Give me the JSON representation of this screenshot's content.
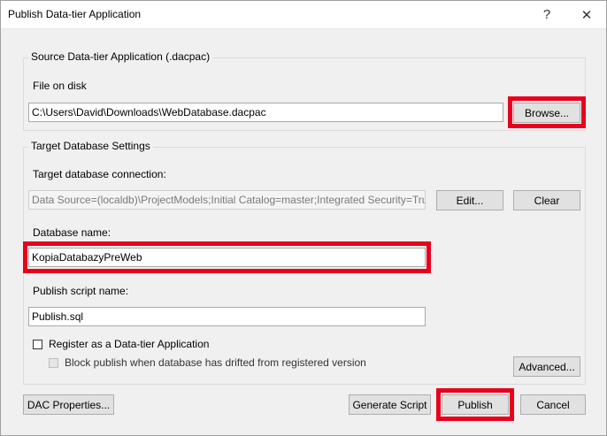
{
  "window": {
    "title": "Publish Data-tier Application",
    "help_glyph": "?",
    "close_glyph": "✕"
  },
  "source": {
    "group_title": "Source Data-tier Application (.dacpac)",
    "file_label": "File on disk",
    "file_value": "C:\\Users\\David\\Downloads\\WebDatabase.dacpac",
    "browse_label": "Browse..."
  },
  "target": {
    "group_title": "Target Database Settings",
    "connection_label": "Target database connection:",
    "connection_value": "Data Source=(localdb)\\ProjectModels;Initial Catalog=master;Integrated Security=Tru",
    "edit_label": "Edit...",
    "clear_label": "Clear",
    "dbname_label": "Database name:",
    "dbname_value": "KopiaDatabazyPreWeb",
    "script_label": "Publish script name:",
    "script_value": "Publish.sql",
    "register_label": "Register as a Data-tier Application",
    "register_checked": false,
    "block_label": "Block publish when database has drifted from registered version",
    "block_checked": false,
    "advanced_label": "Advanced..."
  },
  "footer": {
    "dac_properties_label": "DAC Properties...",
    "generate_script_label": "Generate Script",
    "publish_label": "Publish",
    "cancel_label": "Cancel"
  },
  "colors": {
    "highlight": "#e8001c",
    "window_bg": "#f0f0f0"
  }
}
